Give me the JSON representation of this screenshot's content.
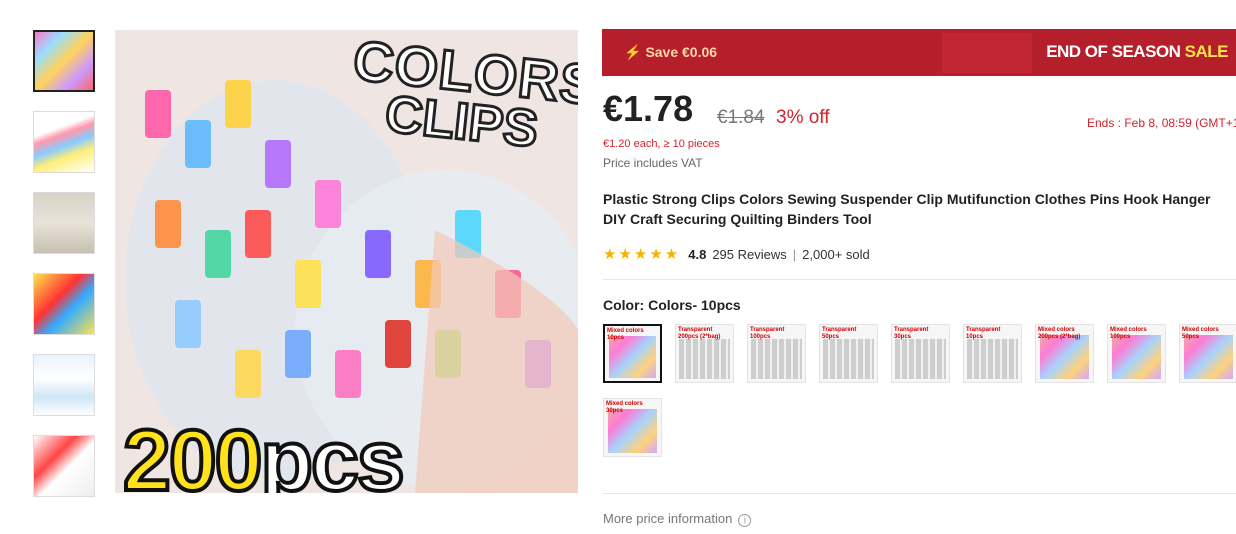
{
  "gallery": {
    "hero_title_line1": "COLORS",
    "hero_title_line2": "CLIPS",
    "hero_count": "200",
    "hero_count_unit": "pcs",
    "thumbnails": 6
  },
  "banner": {
    "save_text": "Save €0.06",
    "promo_main": "END OF SEASON ",
    "promo_highlight": "SALE"
  },
  "pricing": {
    "current_price": "€1.78",
    "original_price": "€1.84",
    "discount": "3% off",
    "ends": "Ends :  Feb 8, 08:59 (GMT+1",
    "bulk": "€1.20 each, ≥ 10 pieces",
    "vat": "Price includes VAT"
  },
  "product": {
    "title": "Plastic Strong Clips Colors Sewing Suspender Clip Mutifunction Clothes Pins Hook Hanger DIY Craft Securing Quilting Binders Tool",
    "rating": "4.8",
    "reviews": "295 Reviews",
    "separator": "|",
    "sold": "2,000+ sold"
  },
  "variants": {
    "label": "Color: Colors- 10pcs",
    "options": [
      {
        "label": "Mixed colors\n10pcs",
        "type": "bag",
        "selected": true
      },
      {
        "label": "Transparent\n200pcs (2*bag)",
        "type": "grid",
        "selected": false
      },
      {
        "label": "Transparent\n100pcs",
        "type": "grid",
        "selected": false
      },
      {
        "label": "Transparent\n50pcs",
        "type": "grid",
        "selected": false
      },
      {
        "label": "Transparent\n30pcs",
        "type": "grid",
        "selected": false
      },
      {
        "label": "Transparent\n10pcs",
        "type": "grid",
        "selected": false
      },
      {
        "label": "Mixed colors\n200pcs (2*bag)",
        "type": "bag",
        "selected": false
      },
      {
        "label": "Mixed colors\n100pcs",
        "type": "bag",
        "selected": false
      },
      {
        "label": "Mixed colors\n50pcs",
        "type": "bag",
        "selected": false
      },
      {
        "label": "Mixed colors\n30pcs",
        "type": "bag",
        "selected": false
      }
    ]
  },
  "footer": {
    "more_price_info": "More price information"
  },
  "colors": {
    "accent_red": "#d2232f",
    "banner_red": "#b51f2c",
    "star_yellow": "#f5b400"
  }
}
